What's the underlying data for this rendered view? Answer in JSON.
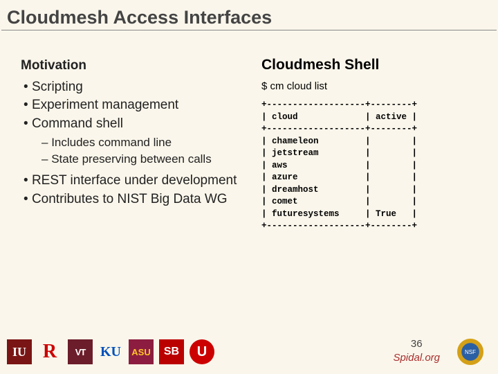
{
  "title": "Cloudmesh Access Interfaces",
  "left": {
    "heading": "Motivation",
    "bullets": {
      "b1": "Scripting",
      "b2": "Experiment management",
      "b3": "Command shell",
      "b3s1": "Includes command line",
      "b3s2": "State preserving between calls",
      "b4": "REST interface under development",
      "b5": "Contributes to NIST Big Data WG"
    }
  },
  "right": {
    "heading": "Cloudmesh Shell",
    "command": "$ cm cloud list",
    "table": {
      "border_top": "+-------------------+--------+",
      "header": "| cloud             | active |",
      "border_mid": "+-------------------+--------+",
      "r1": "| chameleon         |        |",
      "r2": "| jetstream         |        |",
      "r3": "| aws               |        |",
      "r4": "| azure             |        |",
      "r5": "| dreamhost         |        |",
      "r6": "| comet             |        |",
      "r7": "| futuresystems     | True   |",
      "border_bot": "+-------------------+--------+"
    }
  },
  "footer": {
    "page_number": "36",
    "site": "Spidal.org",
    "logos": {
      "iu": "IU",
      "r": "R",
      "vt": "VT",
      "ku": "KU",
      "asu": "ASU",
      "sb": "SB",
      "u": "U",
      "nsf": "NSF"
    }
  }
}
